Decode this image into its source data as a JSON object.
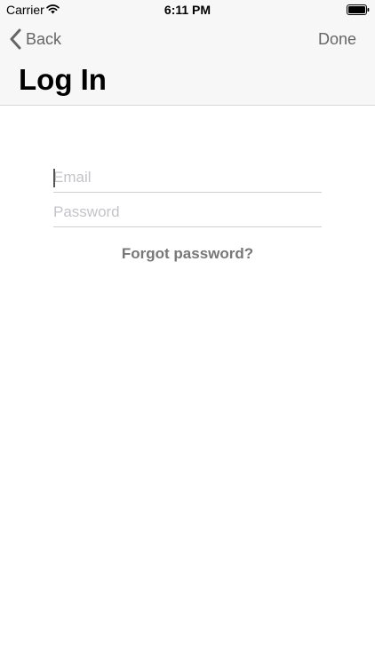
{
  "status_bar": {
    "carrier": "Carrier",
    "time": "6:11 PM"
  },
  "nav": {
    "back_label": "Back",
    "done_label": "Done",
    "title": "Log In"
  },
  "form": {
    "email_placeholder": "Email",
    "email_value": "",
    "password_placeholder": "Password",
    "password_value": ""
  },
  "forgot_password_label": "Forgot password?",
  "colors": {
    "nav_background": "#f7f7f7",
    "nav_button": "#666666",
    "placeholder": "#c4c4c8",
    "link": "#777777",
    "divider": "#d0d0d0"
  },
  "icons": {
    "wifi": "wifi-icon",
    "battery": "battery-icon",
    "back": "chevron-left-icon"
  }
}
